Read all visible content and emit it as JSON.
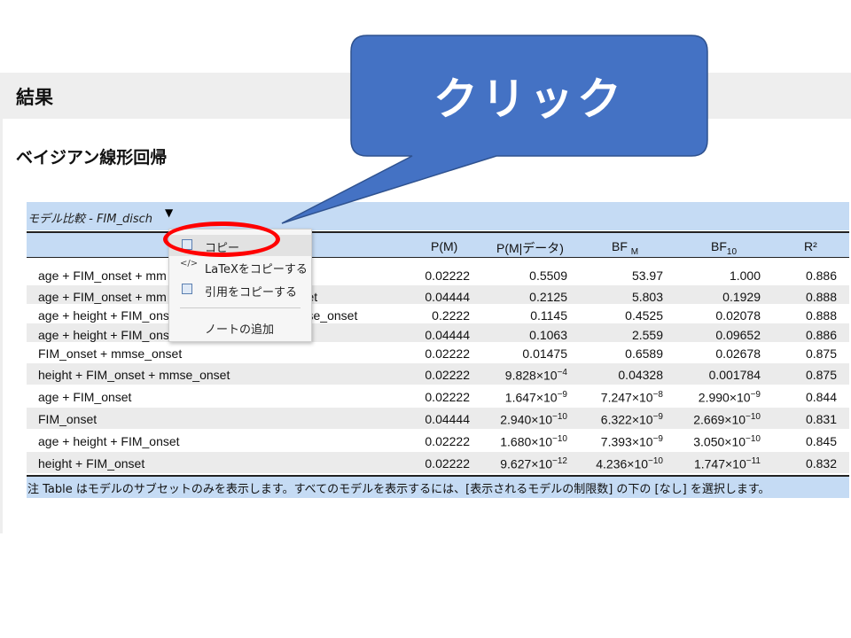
{
  "results": {
    "title": "結果"
  },
  "analysis": {
    "title": "ベイジアン線形回帰"
  },
  "table": {
    "title": "モデル比較 - FIM_disch",
    "columns": {
      "pm": "P(M)",
      "pmdata": "P(M|データ)",
      "bfm": "BF",
      "bfm_sub": "M",
      "bf10": "BF",
      "bf10_sub": "10",
      "r2": "R²"
    },
    "rows": [
      {
        "model": "age + FIM_onset + mm",
        "pm": "0.02222",
        "pmdata": "0.5509",
        "bfm": "53.97",
        "bf10": "1.000",
        "r2": "0.886"
      },
      {
        "model": "age + FIM_onset + mm                                   onset",
        "pm": "0.04444",
        "pmdata": "0.2125",
        "bfm": "5.803",
        "bf10": "0.1929",
        "r2": "0.888"
      },
      {
        "model": "age + height + FIM_ons                              ∗ mmse_onset",
        "pm": "0.2222",
        "pmdata": "0.1145",
        "bfm": "0.4525",
        "bf10": "0.02078",
        "r2": "0.888"
      },
      {
        "model": "age + height + FIM_ons",
        "pm": "0.04444",
        "pmdata": "0.1063",
        "bfm": "2.559",
        "bf10": "0.09652",
        "r2": "0.886"
      },
      {
        "model": "FIM_onset + mmse_onset",
        "pm": "0.02222",
        "pmdata": "0.01475",
        "bfm": "0.6589",
        "bf10": "0.02678",
        "r2": "0.875"
      },
      {
        "model": "height + FIM_onset + mmse_onset",
        "pm": "0.02222",
        "pmdata": "9.828×10",
        "pmdata_exp": "−4",
        "bfm": "0.04328",
        "bf10": "0.001784",
        "r2": "0.875"
      },
      {
        "model": "age + FIM_onset",
        "pm": "0.02222",
        "pmdata": "1.647×10",
        "pmdata_exp": "−9",
        "bfm": "7.247×10",
        "bfm_exp": "−8",
        "bf10": "2.990×10",
        "bf10_exp": "−9",
        "r2": "0.844"
      },
      {
        "model": "FIM_onset",
        "pm": "0.04444",
        "pmdata": "2.940×10",
        "pmdata_exp": "−10",
        "bfm": "6.322×10",
        "bfm_exp": "−9",
        "bf10": "2.669×10",
        "bf10_exp": "−10",
        "r2": "0.831"
      },
      {
        "model": "age + height + FIM_onset",
        "pm": "0.02222",
        "pmdata": "1.680×10",
        "pmdata_exp": "−10",
        "bfm": "7.393×10",
        "bfm_exp": "−9",
        "bf10": "3.050×10",
        "bf10_exp": "−10",
        "r2": "0.845"
      },
      {
        "model": "height + FIM_onset",
        "pm": "0.02222",
        "pmdata": "9.627×10",
        "pmdata_exp": "−12",
        "bfm": "4.236×10",
        "bfm_exp": "−10",
        "bf10": "1.747×10",
        "bf10_exp": "−11",
        "r2": "0.832"
      }
    ],
    "footnote": "注 Table はモデルのサブセットのみを表示します。すべてのモデルを表示するには、[表示されるモデルの制限数] の下の [なし] を選択します。"
  },
  "context_menu": {
    "items": [
      {
        "label": "コピー"
      },
      {
        "label": "LaTeXをコピーする"
      },
      {
        "label": "引用をコピーする"
      },
      {
        "label": "ノートの追加"
      }
    ]
  },
  "callout": {
    "text": "クリック",
    "color": "#4472c4",
    "ring_color": "#ff0000"
  }
}
